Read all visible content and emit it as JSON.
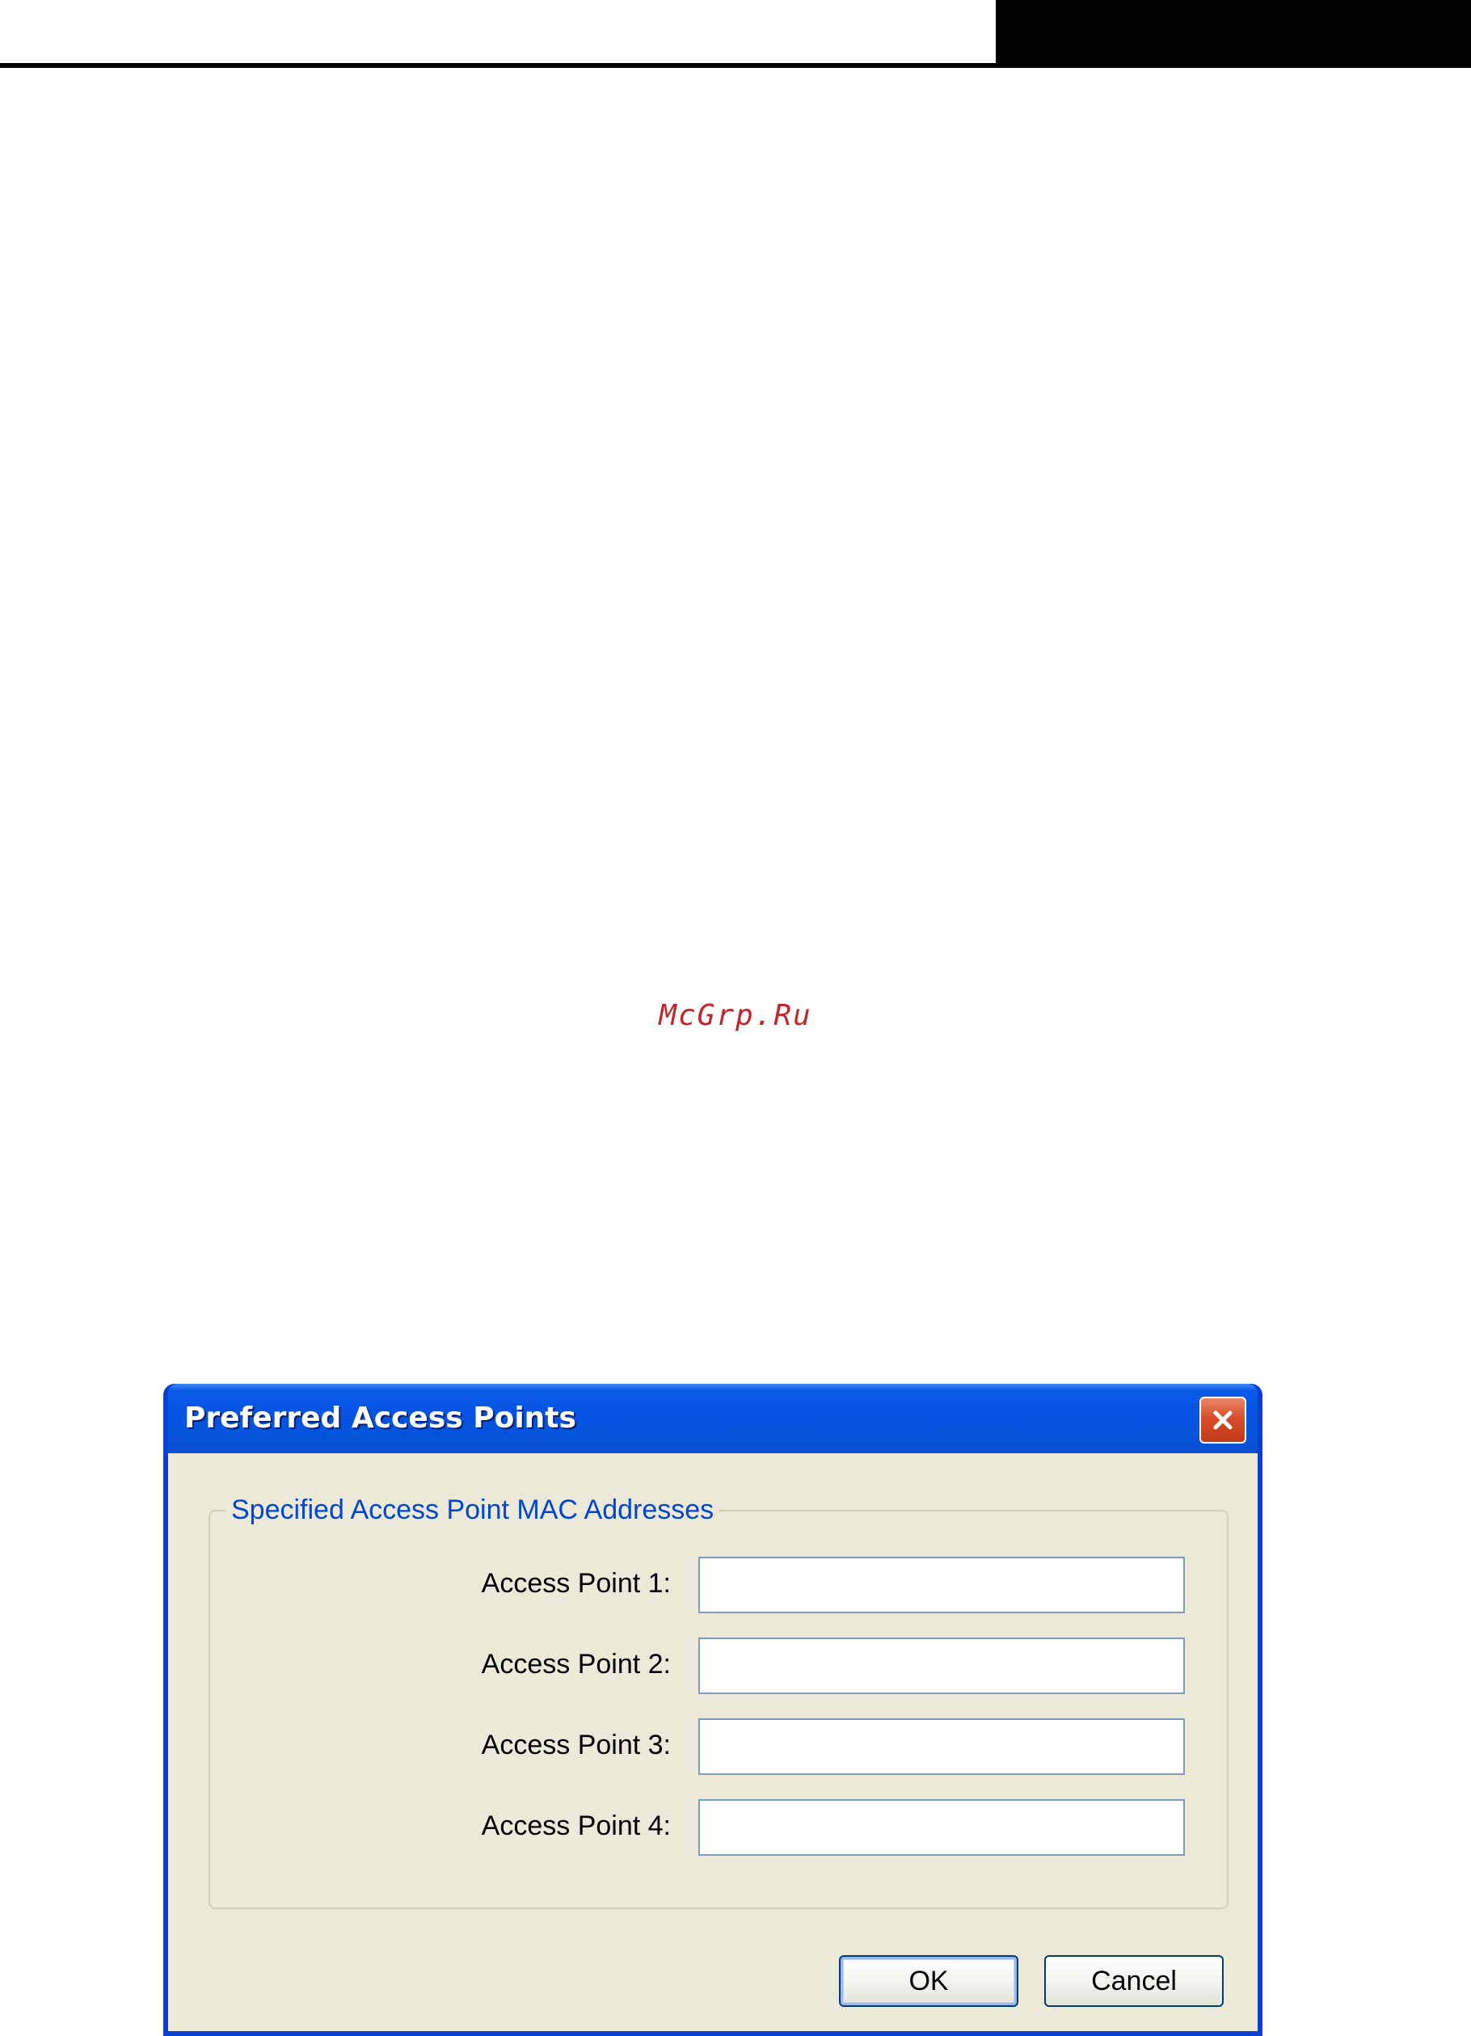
{
  "watermark": "McGrp.Ru",
  "dialog": {
    "title": "Preferred Access Points",
    "group_title": "Specified Access Point MAC Addresses",
    "access_points": [
      {
        "label": "Access Point 1:",
        "value": ""
      },
      {
        "label": "Access Point 2:",
        "value": ""
      },
      {
        "label": "Access Point 3:",
        "value": ""
      },
      {
        "label": "Access Point 4:",
        "value": ""
      }
    ],
    "ok_label": "OK",
    "cancel_label": "Cancel"
  },
  "icons": {
    "close": "close-icon"
  },
  "colors": {
    "titlebar": "#0553e0",
    "client_bg": "#ece9d8",
    "group_title": "#0046d5",
    "close_button": "#d84d2a",
    "watermark": "#c4242c"
  }
}
